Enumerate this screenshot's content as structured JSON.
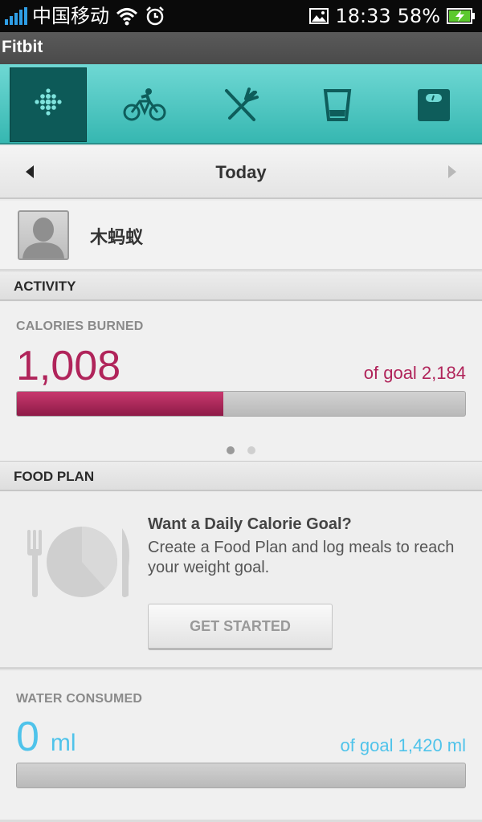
{
  "status_bar": {
    "carrier": "中国移动",
    "time": "18:33",
    "battery": "58%"
  },
  "app": {
    "title": "Fitbit"
  },
  "tabs": [
    {
      "name": "dashboard",
      "icon": "fitbit-dots-icon"
    },
    {
      "name": "exercise",
      "icon": "bicycle-icon"
    },
    {
      "name": "food",
      "icon": "fork-knife-icon"
    },
    {
      "name": "water",
      "icon": "glass-icon"
    },
    {
      "name": "weight",
      "icon": "scale-icon"
    }
  ],
  "date_nav": {
    "label": "Today"
  },
  "profile": {
    "name": "木蚂蚁"
  },
  "activity": {
    "header": "ACTIVITY",
    "label": "CALORIES BURNED",
    "value": "1,008",
    "goal_text": "of goal 2,184",
    "progress_fraction": 0.46,
    "accent": "#b0245a"
  },
  "food_plan": {
    "header": "FOOD PLAN",
    "heading": "Want a Daily Calorie Goal?",
    "body": "Create a Food Plan and log meals to reach your weight goal.",
    "button": "GET STARTED"
  },
  "water": {
    "label": "WATER CONSUMED",
    "value": "0",
    "unit": "ml",
    "goal_text": "of goal 1,420 ml",
    "progress_fraction": 0,
    "accent": "#4fc3ea"
  }
}
